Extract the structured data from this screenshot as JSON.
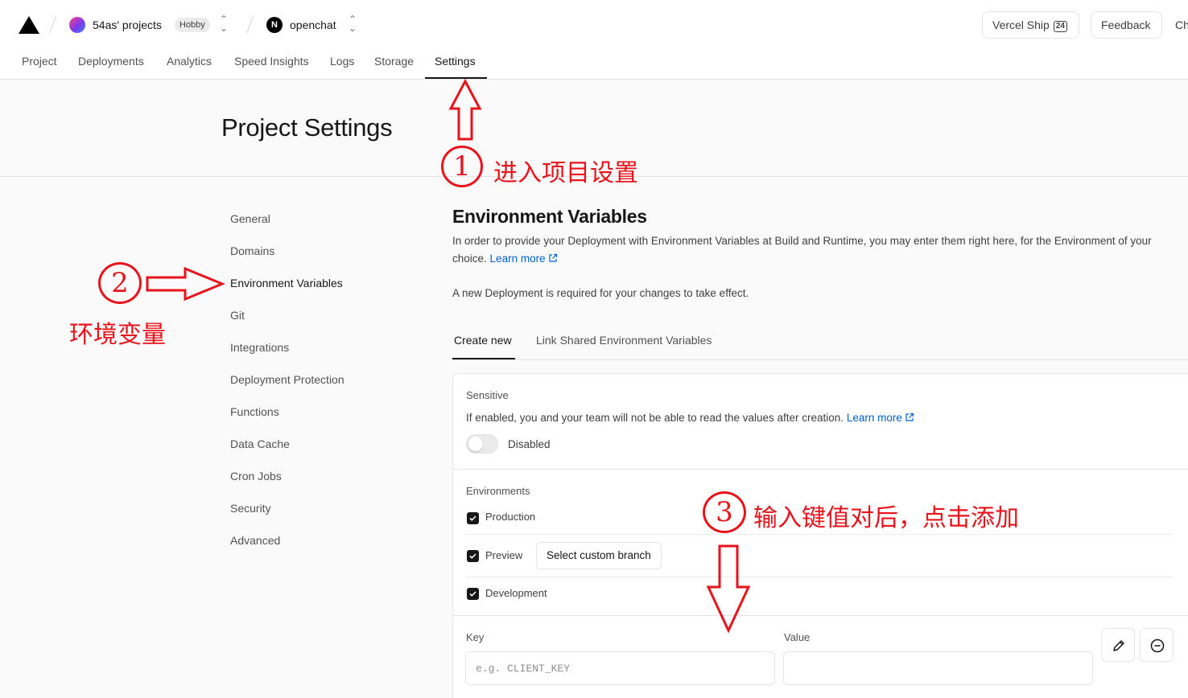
{
  "header": {
    "team_name": "54as' projects",
    "plan_badge": "Hobby",
    "project_initial": "N",
    "project_name": "openchat",
    "ship_label": "Vercel Ship",
    "ship_badge": "24",
    "feedback_label": "Feedback",
    "cut_label": "Ch"
  },
  "nav": {
    "items": [
      "Project",
      "Deployments",
      "Analytics",
      "Speed Insights",
      "Logs",
      "Storage",
      "Settings"
    ],
    "active": "Settings"
  },
  "page": {
    "title": "Project Settings"
  },
  "sidebar": {
    "items": [
      "General",
      "Domains",
      "Environment Variables",
      "Git",
      "Integrations",
      "Deployment Protection",
      "Functions",
      "Data Cache",
      "Cron Jobs",
      "Security",
      "Advanced"
    ],
    "active": "Environment Variables"
  },
  "main": {
    "heading": "Environment Variables",
    "description": "In order to provide your Deployment with Environment Variables at Build and Runtime, you may enter them right here, for the Environment of your choice.",
    "learn_more": "Learn more",
    "note": "A new Deployment is required for your changes to take effect.",
    "tabs": [
      "Create new",
      "Link Shared Environment Variables"
    ],
    "active_tab": "Create new",
    "sensitive": {
      "label": "Sensitive",
      "description": "If enabled, you and your team will not be able to read the values after creation.",
      "learn_more": "Learn more",
      "toggle_state": "Disabled"
    },
    "environments": {
      "label": "Environments",
      "items": [
        {
          "name": "Production",
          "checked": true
        },
        {
          "name": "Preview",
          "checked": true
        },
        {
          "name": "Development",
          "checked": true
        }
      ],
      "custom_branch_label": "Select custom branch"
    },
    "key_label": "Key",
    "key_placeholder": "e.g. CLIENT_KEY",
    "key_value": "",
    "value_label": "Value",
    "value_value": ""
  },
  "annotations": {
    "step1_number": "1",
    "step1_text": "进入项目设置",
    "step2_number": "2",
    "step2_text": "环境变量",
    "step3_number": "3",
    "step3_text": "输入键值对后，点击添加"
  },
  "colors": {
    "accent_link": "#0062d1",
    "annotation_red": "#e8131b",
    "text_primary": "#171717"
  }
}
